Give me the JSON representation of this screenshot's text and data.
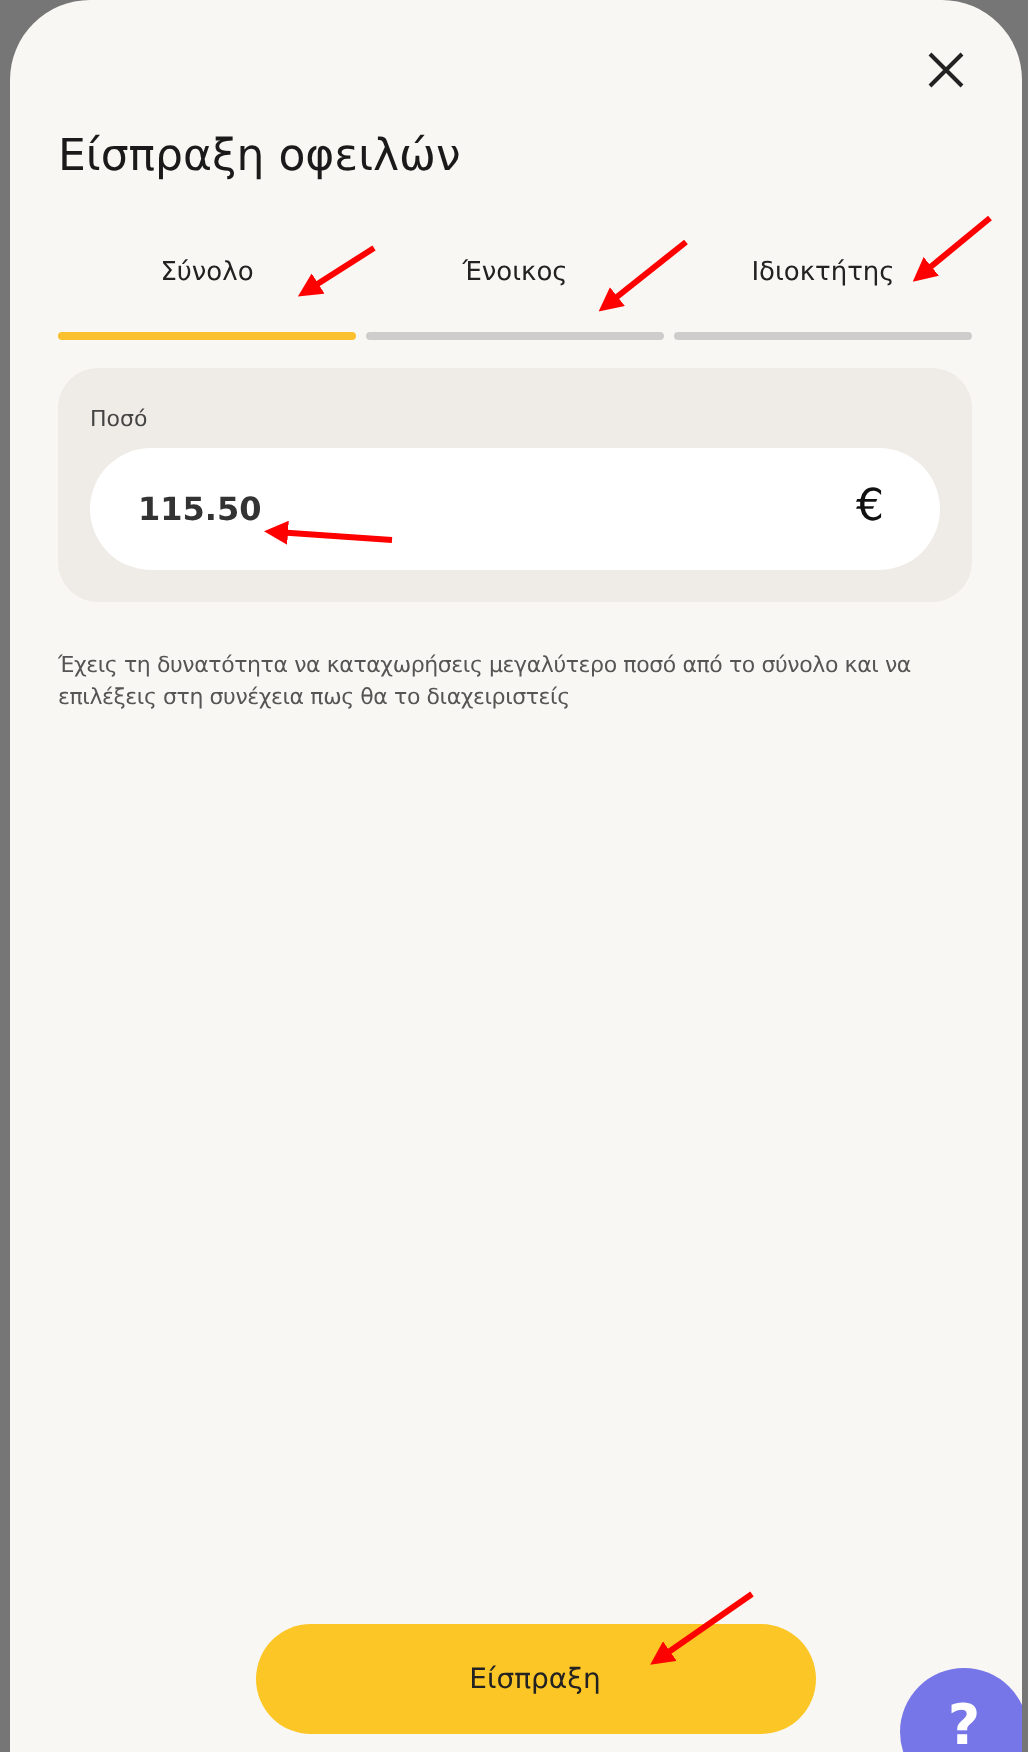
{
  "dialog": {
    "title": "Είσπραξη οφειλών"
  },
  "tabs": [
    {
      "label": "Σύνολο",
      "selected": true
    },
    {
      "label": "Ένοικος",
      "selected": false
    },
    {
      "label": "Ιδιοκτήτης",
      "selected": false
    }
  ],
  "amount": {
    "label": "Ποσό",
    "value": "115.50",
    "currency": "€"
  },
  "hint": "Έχεις τη δυνατότητα να καταχωρήσεις μεγαλύτερο ποσό από το σύνολο και να επιλέξεις στη συνέχεια πως θα το διαχειριστείς",
  "submit_button": "Είσπραξη",
  "help_button": "?"
}
